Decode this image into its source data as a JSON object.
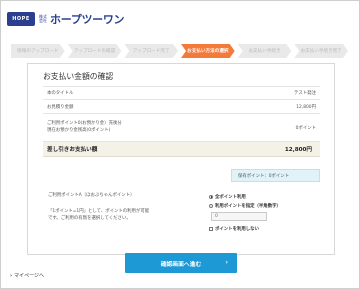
{
  "header": {
    "logo_mark": "HOPE",
    "company_prefix": "株式\n会社",
    "company_name": "ホープツーワン"
  },
  "steps": [
    "情報のアップロード",
    "アップロードの確認",
    "アップロード完了",
    "お支払い方法の選択",
    "お支払い手続き",
    "お支払い手続き完了"
  ],
  "active_step": 3,
  "panel": {
    "title": "お支払い金額の確認",
    "rows": [
      {
        "label": "本のタイトル",
        "value": "テスト発注"
      },
      {
        "label": "お見積り金額",
        "value": "12,800円"
      },
      {
        "label": "ご利用ポイント0(お預かり金）充後分\n現在お預かり金残高(0ポイント)",
        "value": "0ポイント"
      }
    ],
    "total_label": "差し引きお支払い額",
    "total_value": "12,800円",
    "owned_points": "保有ポイント：0ポイント",
    "point_title": "ご利用ポイントA（ほおぶちゃんポイント）",
    "point_note": "「1ポイント=1円」として、ポイントの利用が可能\nです。ご利用の有無を選択してください。",
    "options": {
      "all": "全ポイント利用",
      "specify": "利用ポイントを指定（半角数字）",
      "input_value": "0",
      "none": "ポイントを利用しない"
    }
  },
  "confirm_button": "確認画面へ進む",
  "mypage_link": "マイページへ"
}
